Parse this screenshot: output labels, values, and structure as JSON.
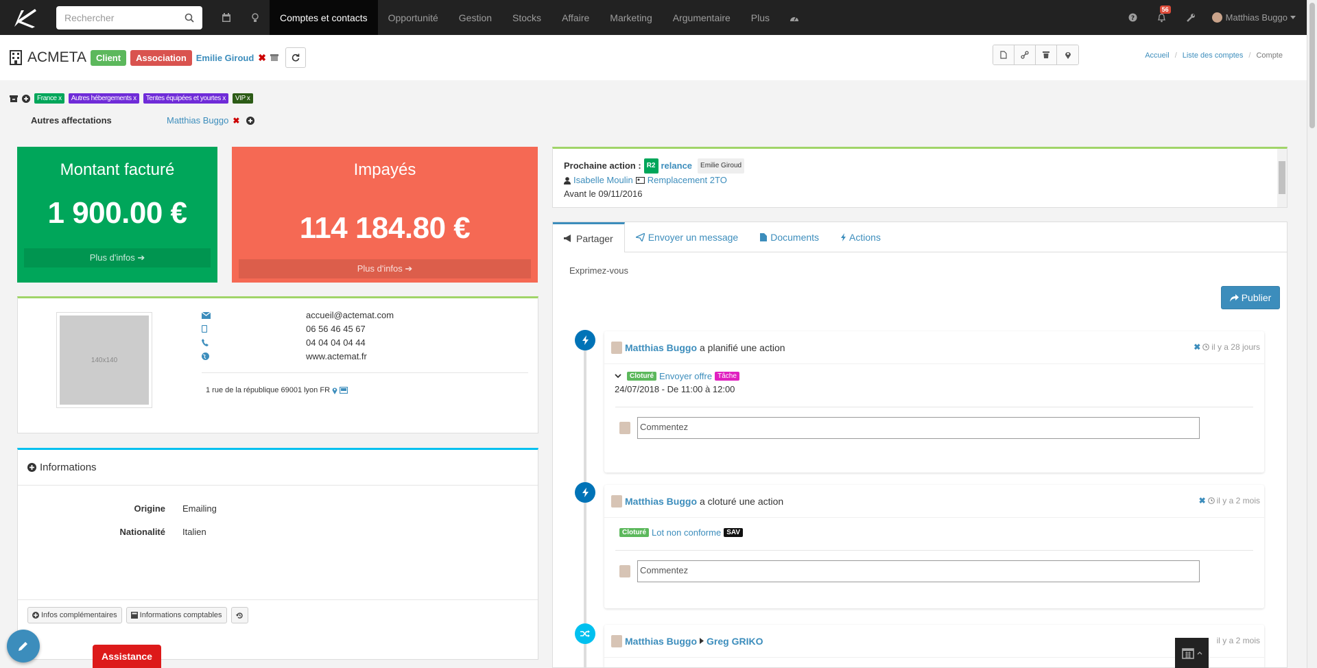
{
  "nav": {
    "search_placeholder": "Rechercher",
    "items": [
      "Comptes et contacts",
      "Opportunité",
      "Gestion",
      "Stocks",
      "Affaire",
      "Marketing",
      "Argumentaire",
      "Plus"
    ],
    "notif_count": "56",
    "user": "Matthias Buggo"
  },
  "account": {
    "name": "ACMETA",
    "label_client": "Client",
    "label_assoc": "Association",
    "owner": "Emilie Giroud"
  },
  "breadcrumb": [
    "Accueil",
    "Liste des comptes",
    "Compte"
  ],
  "tags": [
    {
      "label": "France x",
      "color": "#00a65a"
    },
    {
      "label": "Autres hébergements x",
      "color": "#6f2bd8"
    },
    {
      "label": "Tentes équipées et yourtes x",
      "color": "#6f2bd8"
    },
    {
      "label": "VIP x",
      "color": "#2c5b16"
    }
  ],
  "affect": {
    "label": "Autres affectations",
    "person": "Matthias Buggo"
  },
  "kpi": {
    "billed_title": "Montant facturé",
    "billed_value": "1 900.00 €",
    "unpaid_title": "Impayés",
    "unpaid_value": "114 184.80 €",
    "more": "Plus d'infos"
  },
  "contact": {
    "photo": "140x140",
    "email": "accueil@actemat.com",
    "mobile": "06 56 46 45 67",
    "phone": "04 04 04 04 44",
    "web": "www.actemat.fr",
    "address": "1 rue de la république 69001 lyon FR"
  },
  "info": {
    "title": "Informations",
    "rows": [
      {
        "k": "Origine",
        "v": "Emailing"
      },
      {
        "k": "Nationalité",
        "v": "Italien"
      }
    ],
    "btn1": "Infos complémentaires",
    "btn2": "Informations comptables"
  },
  "next": {
    "label": "Prochaine action :",
    "code": "R2",
    "action": "relance",
    "owner": "Emilie Giroud",
    "contact": "Isabelle Moulin",
    "subject": "Remplacement 2TO",
    "due": "Avant le 09/11/2016"
  },
  "tabs": [
    "Partager",
    "Envoyer un message",
    "Documents",
    "Actions"
  ],
  "composer": {
    "placeholder": "Exprimez-vous",
    "publish": "Publier"
  },
  "timeline": [
    {
      "user": "Matthias Buggo",
      "verb": "a planifié une action",
      "time": "il y a 28 jours",
      "status": "Cloturé",
      "title": "Envoyer offre",
      "type": "Tâche",
      "date": "24/07/2018 - De 11:00 à 12:00",
      "comment": "Commentez"
    },
    {
      "user": "Matthias Buggo",
      "verb": "a cloturé une action",
      "time": "il y a 2 mois",
      "status": "Cloturé",
      "title": "Lot non conforme",
      "type": "SAV",
      "comment": "Commentez"
    },
    {
      "user": "Matthias Buggo",
      "target": "Greg GRIKO",
      "time": "il y a 2 mois"
    }
  ],
  "assist": "Assistance"
}
